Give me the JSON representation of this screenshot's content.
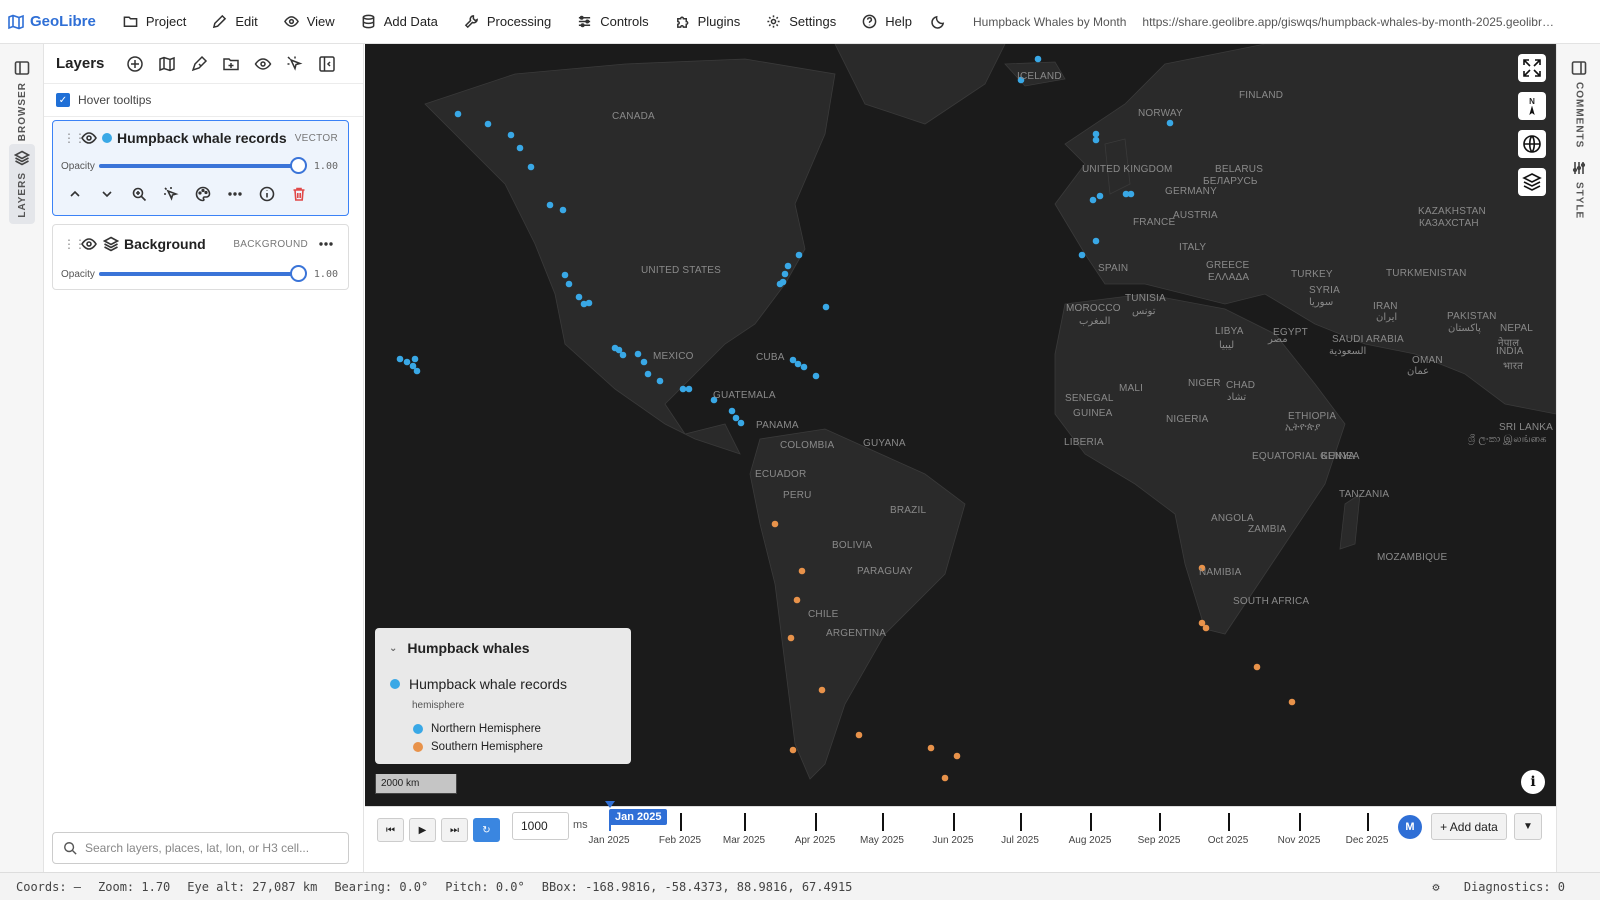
{
  "topbar": {
    "brand": "GeoLibre",
    "menu": [
      "Project",
      "Edit",
      "View",
      "Add Data",
      "Processing",
      "Controls",
      "Plugins",
      "Settings",
      "Help"
    ],
    "project_title": "Humpback Whales by Month",
    "share_url": "https://share.geolibre.app/giswqs/humpback-whales-by-month-2025.geolibre...."
  },
  "left_rail": {
    "browser_label": "BROWSER",
    "layers_label": "LAYERS"
  },
  "right_rail": {
    "comments_label": "COMMENTS",
    "style_label": "STYLE"
  },
  "layers_panel": {
    "title": "Layers",
    "hover_tooltips_label": "Hover tooltips",
    "hover_tooltips_checked": true,
    "layers": [
      {
        "name": "Humpback whale records",
        "type": "VECTOR",
        "opacity_label": "Opacity",
        "opacity": "1.00",
        "color": "#39a8e6"
      },
      {
        "name": "Background",
        "type": "BACKGROUND",
        "opacity_label": "Opacity",
        "opacity": "1.00"
      }
    ],
    "search_placeholder": "Search layers, places, lat, lon, or H3 cell..."
  },
  "map": {
    "labels": [
      {
        "text": "ICELAND"
      },
      {
        "text": "FINLAND"
      },
      {
        "text": "NORWAY"
      },
      {
        "text": "CANADA"
      },
      {
        "text": "UNITED KINGDOM"
      },
      {
        "text": "BELARUS"
      },
      {
        "text": "БЕЛАРУСЬ"
      },
      {
        "text": "GERMANY"
      },
      {
        "text": "KAZAKHSTAN"
      },
      {
        "text": "КАЗАХСТАН"
      },
      {
        "text": "FRANCE"
      },
      {
        "text": "AUSTRIA"
      },
      {
        "text": "UNITED STATES"
      },
      {
        "text": "ITALY"
      },
      {
        "text": "SPAIN"
      },
      {
        "text": "GREECE"
      },
      {
        "text": "ΕΛΛΑΔΑ"
      },
      {
        "text": "TURKEY"
      },
      {
        "text": "TURKMENISTAN"
      },
      {
        "text": "TUNISIA"
      },
      {
        "text": "تونس"
      },
      {
        "text": "SYRIA"
      },
      {
        "text": "سوريا"
      },
      {
        "text": "MOROCCO"
      },
      {
        "text": "المغرب"
      },
      {
        "text": "IRAN"
      },
      {
        "text": "ایران"
      },
      {
        "text": "PAKISTAN"
      },
      {
        "text": "پاکستان"
      },
      {
        "text": "LIBYA"
      },
      {
        "text": "ليبيا"
      },
      {
        "text": "EGYPT"
      },
      {
        "text": "مصر"
      },
      {
        "text": "SAUDI ARABIA"
      },
      {
        "text": "السعودية"
      },
      {
        "text": "NEPAL"
      },
      {
        "text": "नेपाल"
      },
      {
        "text": "MEXICO"
      },
      {
        "text": "CUBA"
      },
      {
        "text": "INDIA"
      },
      {
        "text": "भारत"
      },
      {
        "text": "OMAN"
      },
      {
        "text": "عمان"
      },
      {
        "text": "MALI"
      },
      {
        "text": "NIGER"
      },
      {
        "text": "CHAD"
      },
      {
        "text": "تشاد"
      },
      {
        "text": "SENEGAL"
      },
      {
        "text": "GUINEA"
      },
      {
        "text": "GUATEMALA"
      },
      {
        "text": "NIGERIA"
      },
      {
        "text": "ETHIOPIA"
      },
      {
        "text": "ኢትዮጵያ"
      },
      {
        "text": "SRI LANKA"
      },
      {
        "text": "ශ්‍රී ලංකා இலங்கை"
      },
      {
        "text": "PANAMA"
      },
      {
        "text": "COLOMBIA"
      },
      {
        "text": "GUYANA"
      },
      {
        "text": "LIBERIA"
      },
      {
        "text": "EQUATORIAL GUINEA"
      },
      {
        "text": "KENYA"
      },
      {
        "text": "ECUADOR"
      },
      {
        "text": "PERU"
      },
      {
        "text": "BRAZIL"
      },
      {
        "text": "TANZANIA"
      },
      {
        "text": "ANGOLA"
      },
      {
        "text": "BOLIVIA"
      },
      {
        "text": "ZAMBIA"
      },
      {
        "text": "MOZAMBIQUE"
      },
      {
        "text": "PARAGUAY"
      },
      {
        "text": "NAMIBIA"
      },
      {
        "text": "SOUTH AFRICA"
      },
      {
        "text": "CHILE"
      },
      {
        "text": "ARGENTINA"
      }
    ],
    "compass_label": "N",
    "scale_label": "2000 km",
    "info_label": "i",
    "legend": {
      "title": "Humpback whales",
      "layer_name": "Humpback whale records",
      "field": "hemisphere",
      "items": [
        {
          "label": "Northern Hemisphere",
          "color": "#39a8e6"
        },
        {
          "label": "Southern Hemisphere",
          "color": "#e8924a"
        }
      ]
    }
  },
  "timeline": {
    "interval_value": "1000",
    "interval_unit": "ms",
    "current": "Jan 2025",
    "months": [
      "Jan 2025",
      "Feb 2025",
      "Mar 2025",
      "Apr 2025",
      "May 2025",
      "Jun 2025",
      "Jul 2025",
      "Aug 2025",
      "Sep 2025",
      "Oct 2025",
      "Nov 2025",
      "Dec 2025"
    ],
    "avatar": "M",
    "add_data_label": "+ Add data"
  },
  "statusbar": {
    "coords": "Coords: —",
    "zoom": "Zoom: 1.70",
    "eye_alt": "Eye alt: 27,087 km",
    "bearing": "Bearing: 0.0°",
    "pitch": "Pitch: 0.0°",
    "bbox": "BBox: -168.9816, -58.4373, 88.9816, 67.4915",
    "diagnostics": "Diagnostics: 0"
  }
}
